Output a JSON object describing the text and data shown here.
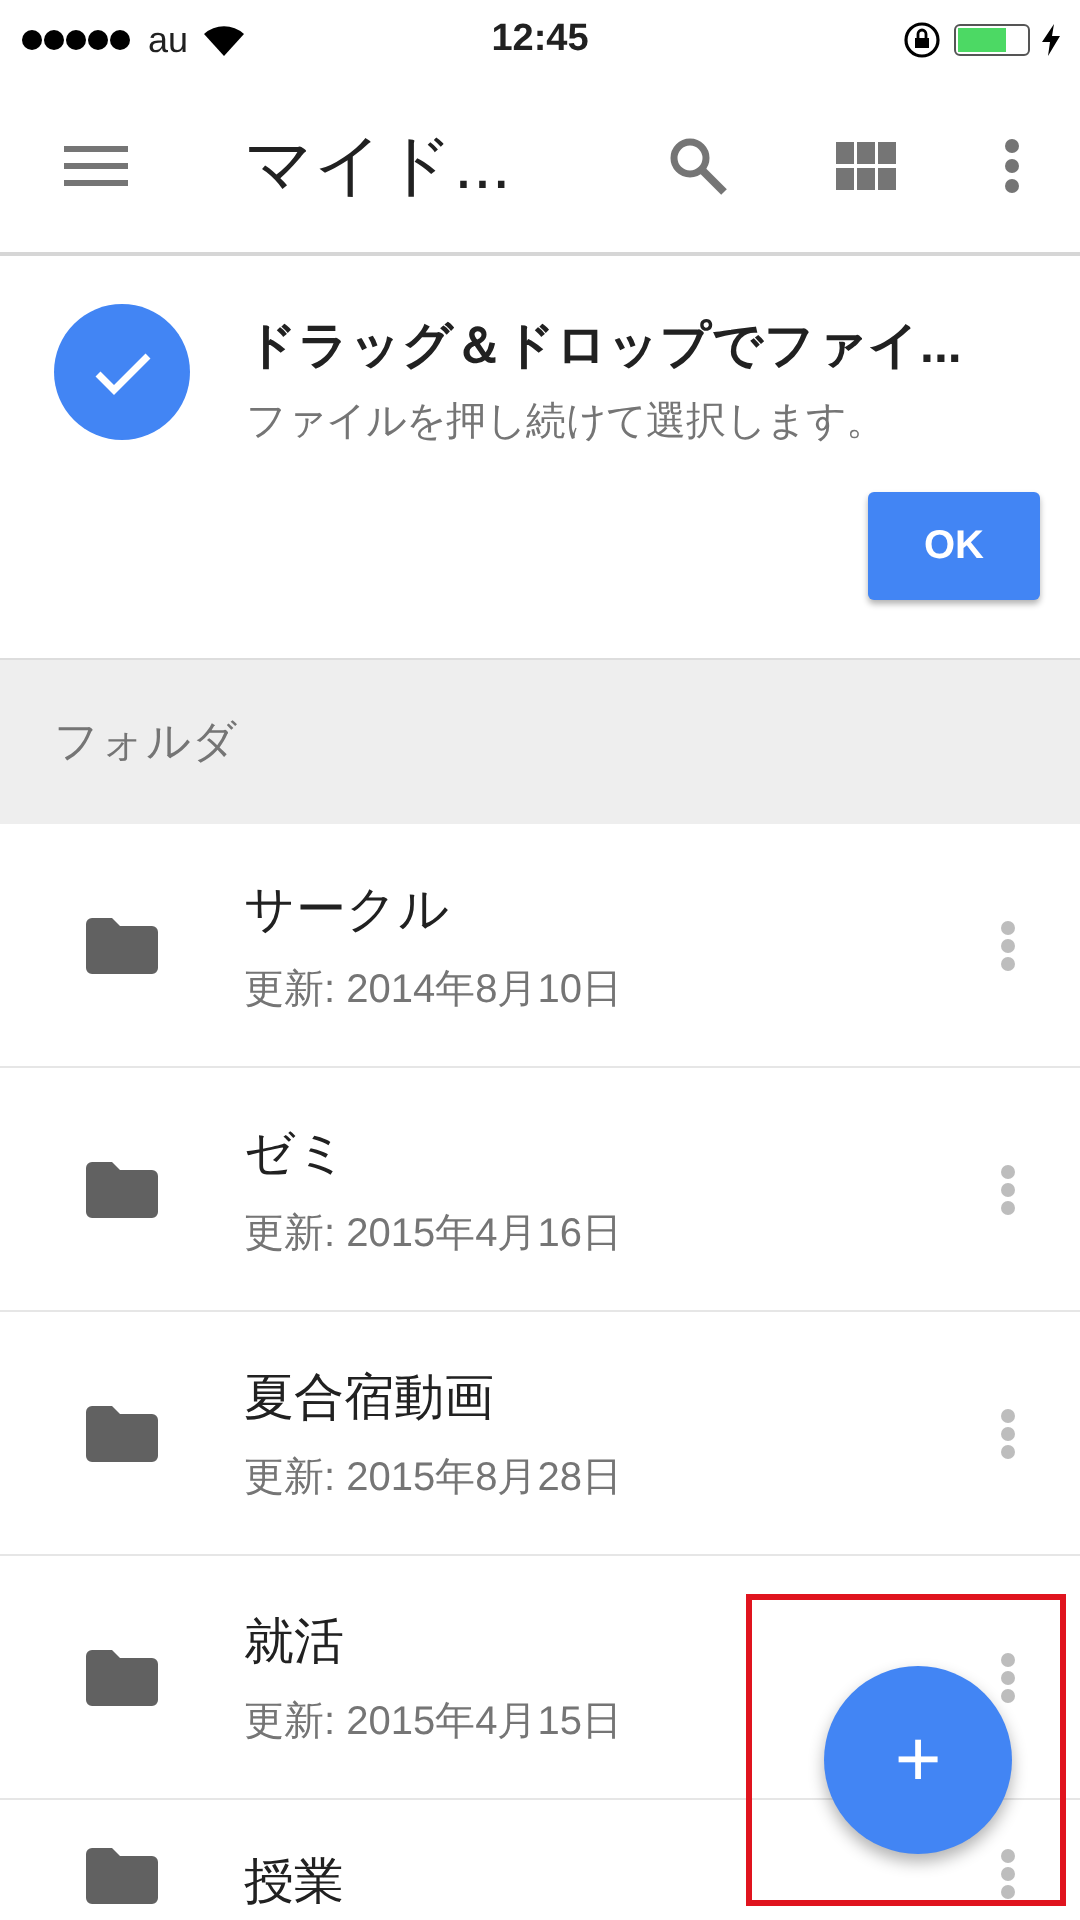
{
  "status_bar": {
    "carrier": "au",
    "time": "12:45"
  },
  "header": {
    "title": "マイド..."
  },
  "banner": {
    "title": "ドラッグ＆ドロップでファイ...",
    "subtitle": "ファイルを押し続けて選択します。",
    "button": "OK"
  },
  "section": {
    "label": "フォルダ"
  },
  "folders": [
    {
      "name": "サークル",
      "updated": "更新: 2014年8月10日"
    },
    {
      "name": "ゼミ",
      "updated": "更新: 2015年4月16日"
    },
    {
      "name": "夏合宿動画",
      "updated": "更新: 2015年8月28日"
    },
    {
      "name": "就活",
      "updated": "更新: 2015年4月15日"
    },
    {
      "name": "授業"
    }
  ],
  "fab": {
    "label": "+"
  }
}
